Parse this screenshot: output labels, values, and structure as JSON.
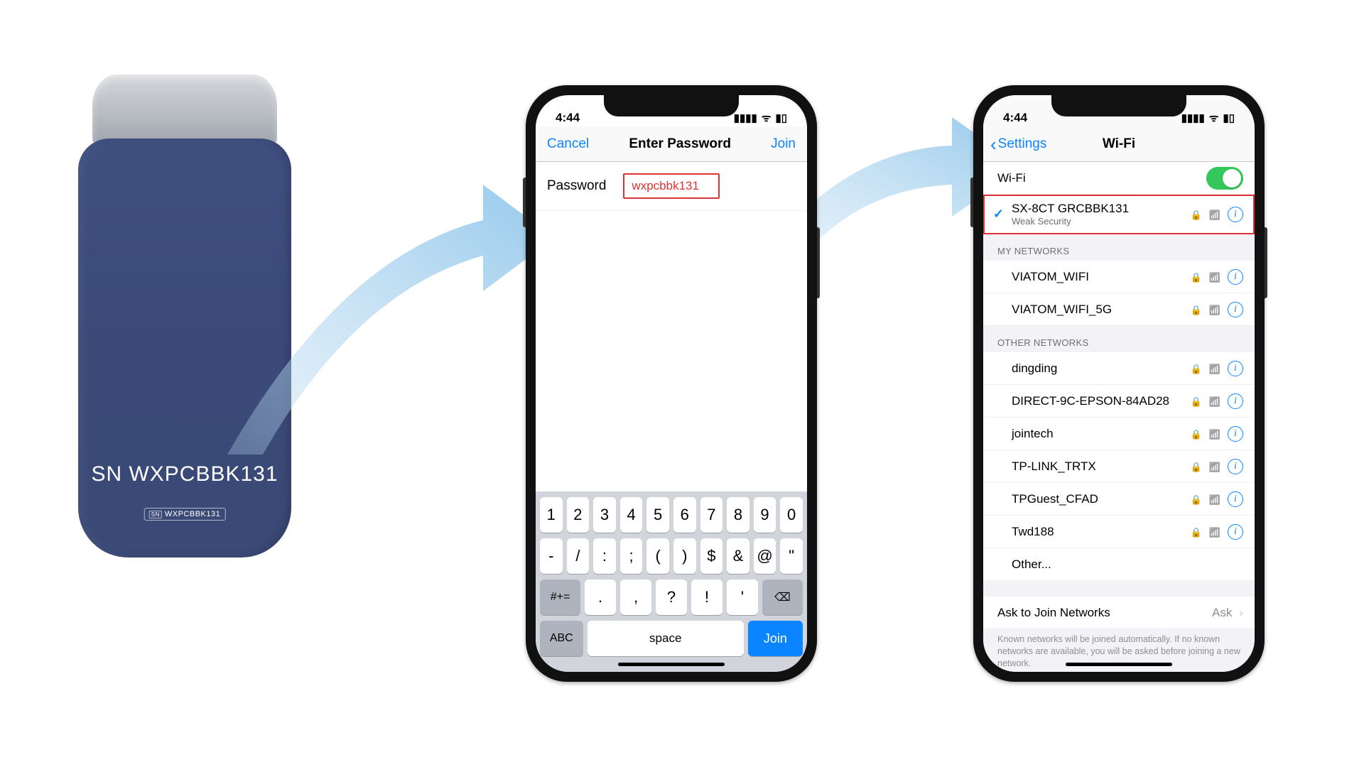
{
  "device": {
    "sn_label": "SN WXPCBBK131",
    "tag_sn": "SN",
    "tag_value": "WXPCBBK131"
  },
  "phoneA": {
    "time": "4:44",
    "nav_cancel": "Cancel",
    "nav_title": "Enter Password",
    "nav_join": "Join",
    "password_label": "Password",
    "password_value": "wxpcbbk131",
    "keyboard": {
      "row1": [
        "1",
        "2",
        "3",
        "4",
        "5",
        "6",
        "7",
        "8",
        "9",
        "0"
      ],
      "row2": [
        "-",
        "/",
        ":",
        ";",
        "(",
        ")",
        "$",
        "&",
        "@",
        "\""
      ],
      "row3_mode": "#+=",
      "row3": [
        ".",
        ",",
        "?",
        "!",
        "'"
      ],
      "row3_del": "⌫",
      "row4_abc": "ABC",
      "row4_space": "space",
      "row4_join": "Join"
    }
  },
  "phoneB": {
    "time": "4:44",
    "back_label": "Settings",
    "title": "Wi-Fi",
    "wifi_row_label": "Wi-Fi",
    "connected": {
      "ssid": "SX-8CT GRCBBK131",
      "subtitle": "Weak Security"
    },
    "section_my": "MY NETWORKS",
    "my_networks": [
      "VIATOM_WIFI",
      "VIATOM_WIFI_5G"
    ],
    "section_other": "OTHER NETWORKS",
    "other_networks": [
      "dingding",
      "DIRECT-9C-EPSON-84AD28",
      "jointech",
      "TP-LINK_TRTX",
      "TPGuest_CFAD",
      "Twd188"
    ],
    "other_more": "Other...",
    "ask_label": "Ask to Join Networks",
    "ask_value": "Ask",
    "footer": "Known networks will be joined automatically. If no known networks are available, you will be asked before joining a new network."
  }
}
